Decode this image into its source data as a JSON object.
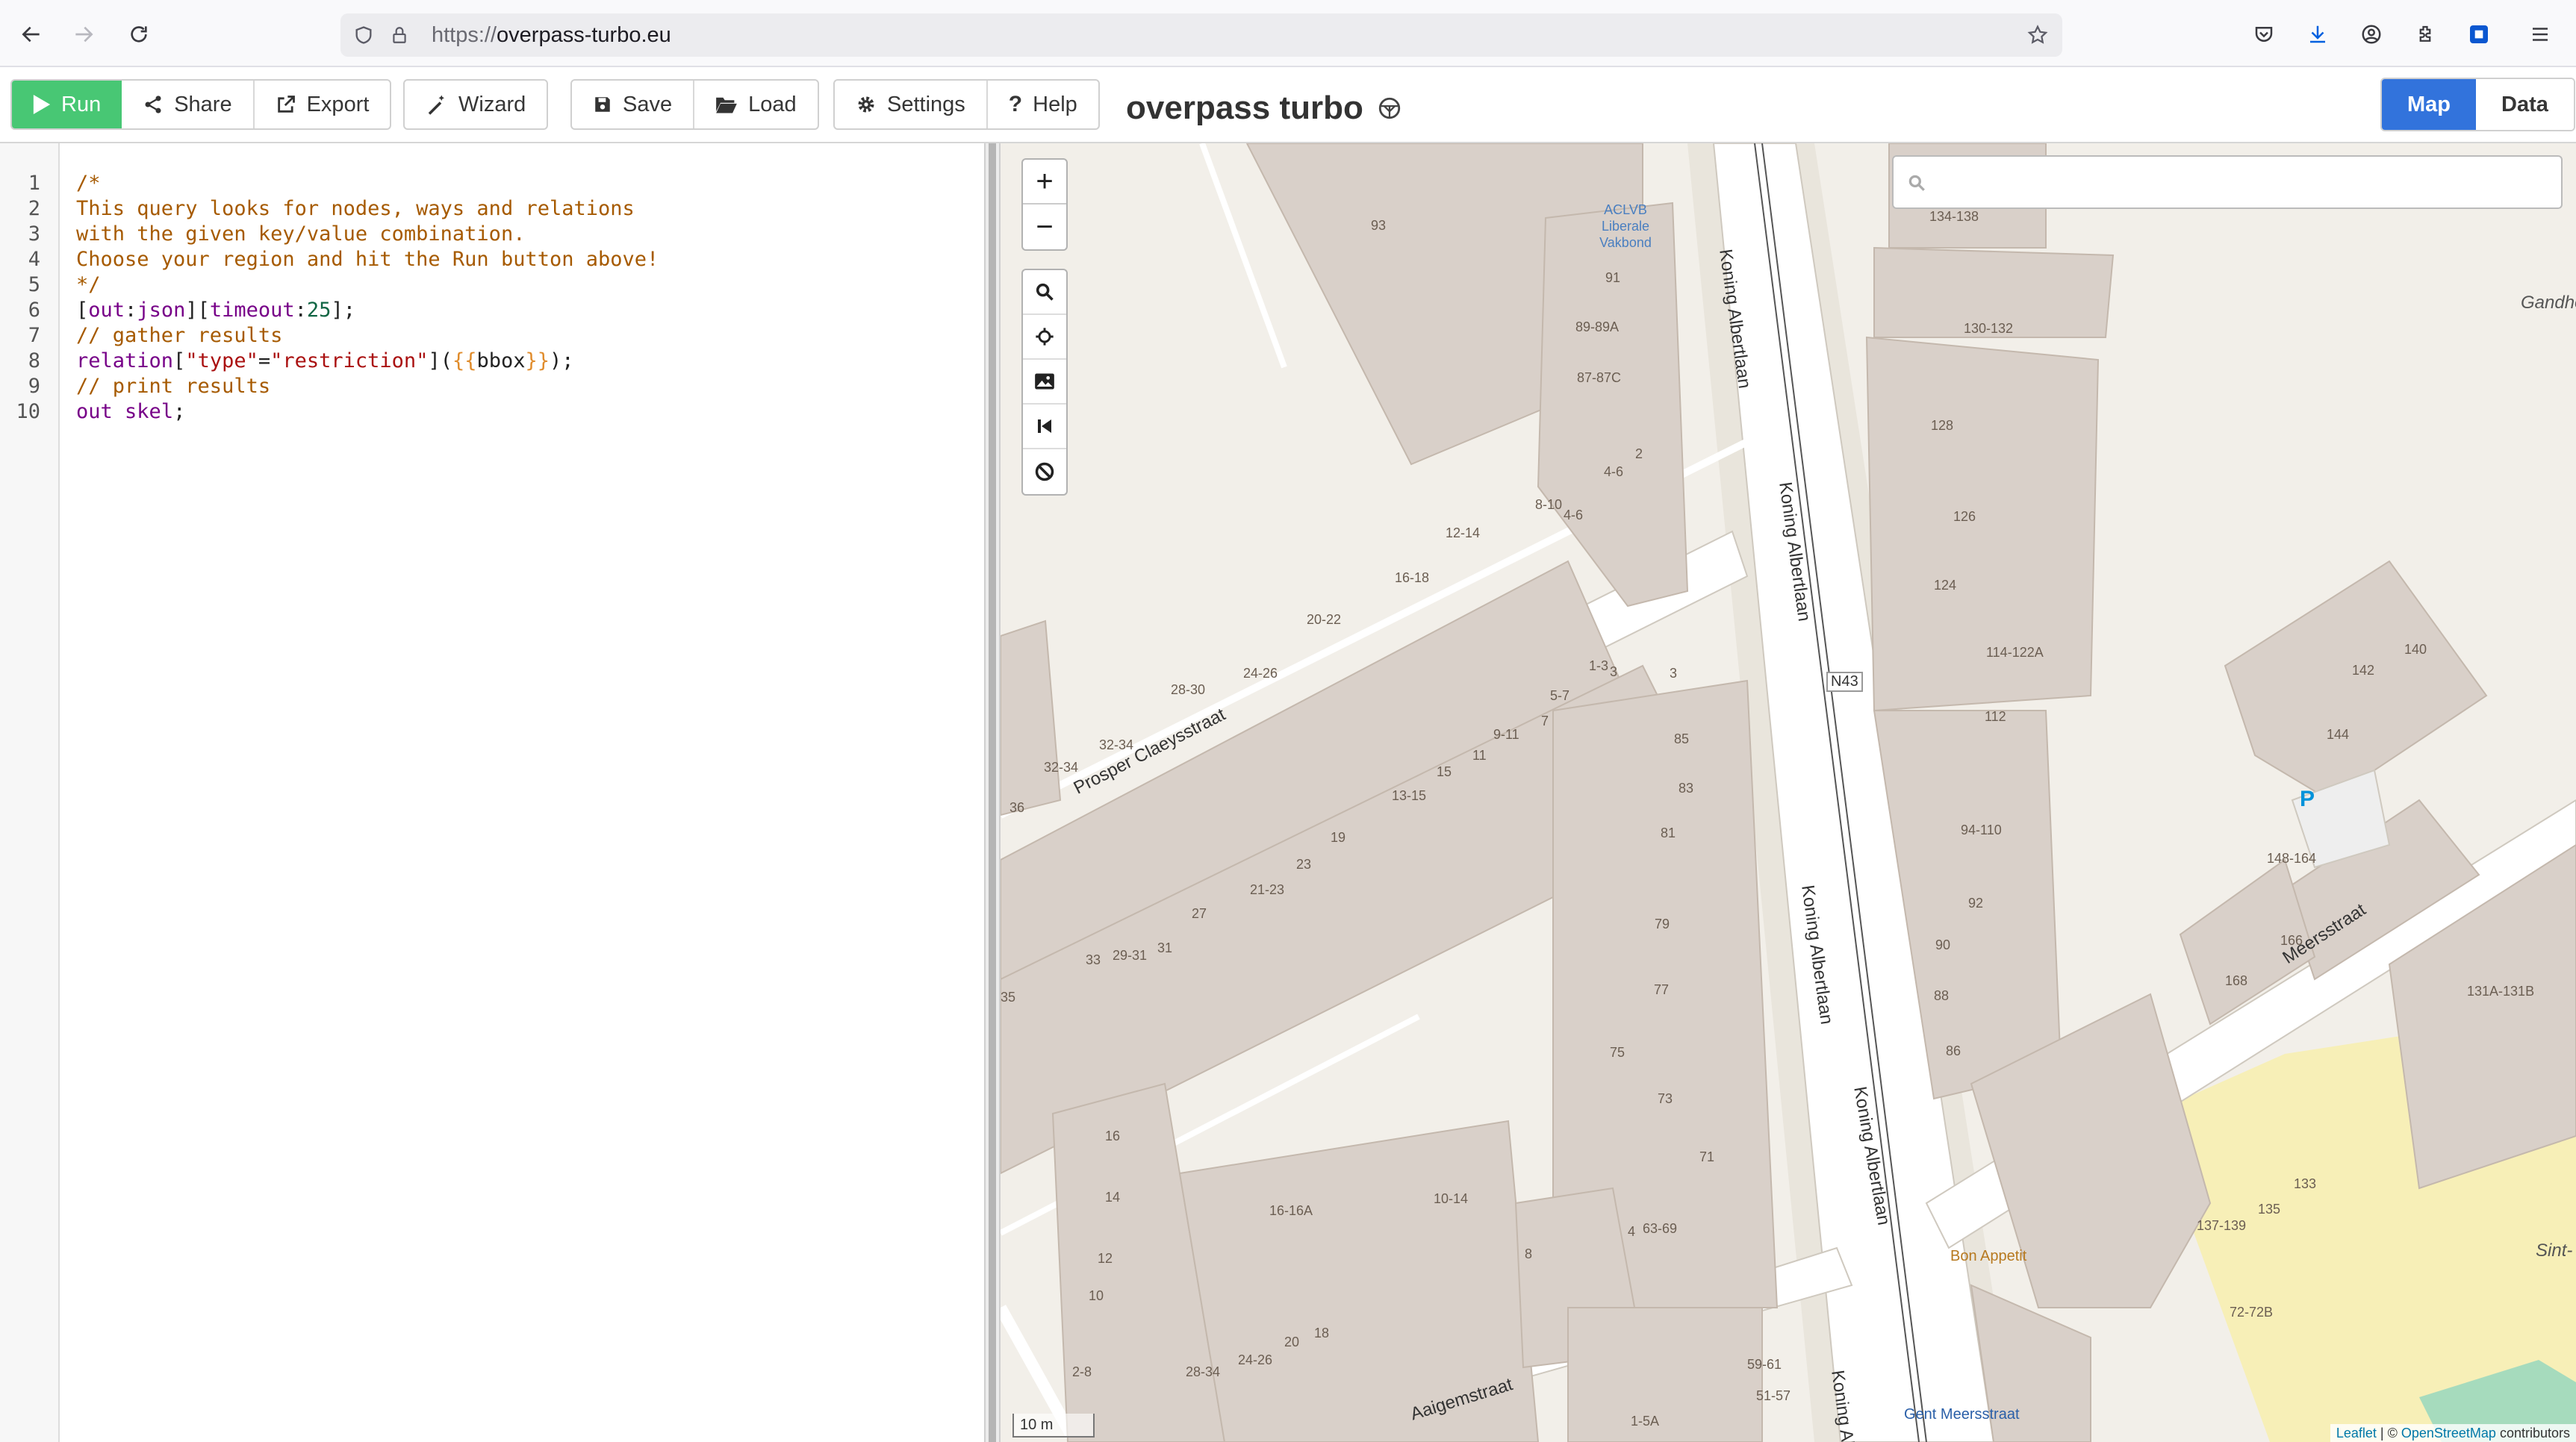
{
  "browser": {
    "url_protocol": "https://",
    "url_host": "overpass-turbo.eu"
  },
  "toolbar": {
    "run_label": "Run",
    "share_label": "Share",
    "export_label": "Export",
    "wizard_label": "Wizard",
    "save_label": "Save",
    "load_label": "Load",
    "settings_label": "Settings",
    "help_label": "Help",
    "app_title": "overpass turbo",
    "map_tab": "Map",
    "data_tab": "Data"
  },
  "editor": {
    "line_numbers": [
      "1",
      "2",
      "3",
      "4",
      "5",
      "6",
      "7",
      "8",
      "9",
      "10"
    ]
  },
  "map": {
    "search_placeholder": "",
    "scale_label": "10 m",
    "attribution_leaflet": "Leaflet",
    "attribution_sep": " | © ",
    "attribution_osm": "OpenStreetMap",
    "attribution_tail": " contributors",
    "streets": {
      "koning_albertlaan": "Koning Albertlaan",
      "prosper_claeysstraat": "Prosper Claeysstraat",
      "meersstraat": "Meersstraat",
      "aaigemstraat": "Aaigemstraat",
      "n43": "N43",
      "gandhorn": "Gandhor",
      "sint": "Sint-",
      "gent_meersstraat": "Gent Meersstraat",
      "koning_alb_bottom": "Koning Alb"
    },
    "pois": {
      "aclvb": "ACLVB Liberale Vakbond",
      "bon_appetit": "Bon Appetit"
    },
    "house_numbers": [
      "93",
      "91",
      "89-89A",
      "87-87C",
      "2",
      "4-6",
      "8-10",
      "4-6",
      "12-14",
      "16-18",
      "20-22",
      "24-26",
      "28-30",
      "32-34",
      "32-34",
      "36",
      "1-3",
      "3",
      "3",
      "5-7",
      "7",
      "9-11",
      "11",
      "15",
      "13-15",
      "19",
      "23",
      "21-23",
      "27",
      "31",
      "29-31",
      "33",
      "35",
      "85",
      "83",
      "81",
      "79",
      "77",
      "75",
      "73",
      "71",
      "63-69",
      "16",
      "14",
      "12",
      "10",
      "2-8",
      "28-34",
      "24-26",
      "20",
      "18",
      "16-16A",
      "10-14",
      "8",
      "4",
      "59-61",
      "51-57",
      "1-5A",
      "134-138",
      "130-132",
      "128",
      "126",
      "124",
      "114-122A",
      "112",
      "94-110",
      "92",
      "90",
      "88",
      "86",
      "142",
      "140",
      "144",
      "148-164",
      "166",
      "168",
      "131A-131B",
      "133",
      "135",
      "137-139",
      "72-72B"
    ]
  }
}
